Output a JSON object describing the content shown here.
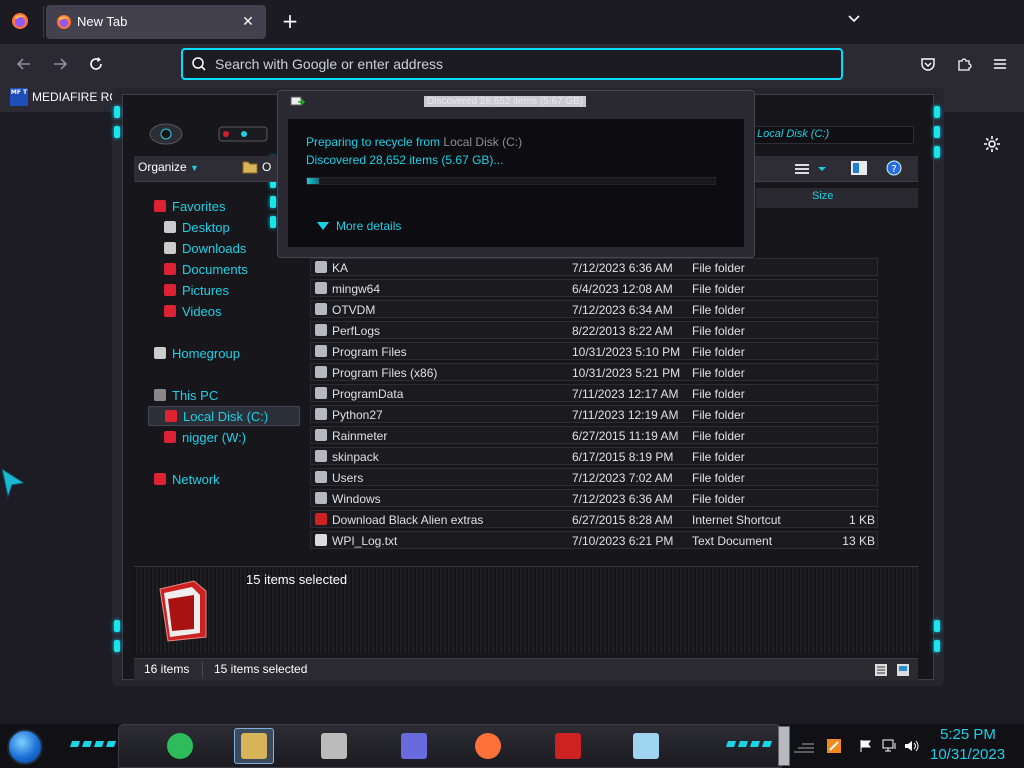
{
  "browser": {
    "tab": {
      "title": "New Tab",
      "close": "✕"
    },
    "new_tab": "+",
    "urlbar": {
      "placeholder": "Search with Google or enter address",
      "value": ""
    },
    "bookmark": {
      "icon_text": "MF T",
      "label": "MEDIAFIRE ROU"
    },
    "accent": "#00ddff"
  },
  "explorer": {
    "toolbar": {
      "organize": "Organize",
      "open_trunc": "O"
    },
    "address_right": "Local Disk (C:)",
    "column_size": "Size",
    "nav": [
      {
        "label": "Favorites",
        "icon": "star-icon"
      },
      {
        "label": "Desktop",
        "icon": "desktop-icon"
      },
      {
        "label": "Downloads",
        "icon": "downloads-icon"
      },
      {
        "label": "Documents",
        "icon": "documents-icon"
      },
      {
        "label": "Pictures",
        "icon": "pictures-icon"
      },
      {
        "label": "Videos",
        "icon": "videos-icon"
      },
      {
        "label": "Homegroup",
        "icon": "homegroup-icon"
      },
      {
        "label": "This PC",
        "icon": "computer-icon"
      },
      {
        "label": "Local Disk (C:)",
        "icon": "drive-icon"
      },
      {
        "label": "nigger (W:)",
        "icon": "drive-icon"
      },
      {
        "label": "Network",
        "icon": "network-icon"
      }
    ],
    "files": [
      {
        "name": "KA",
        "date": "7/12/2023 6:36 AM",
        "type": "File folder",
        "size": ""
      },
      {
        "name": "mingw64",
        "date": "6/4/2023 12:08 AM",
        "type": "File folder",
        "size": ""
      },
      {
        "name": "OTVDM",
        "date": "7/12/2023 6:34 AM",
        "type": "File folder",
        "size": ""
      },
      {
        "name": "PerfLogs",
        "date": "8/22/2013 8:22 AM",
        "type": "File folder",
        "size": ""
      },
      {
        "name": "Program Files",
        "date": "10/31/2023 5:10 PM",
        "type": "File folder",
        "size": ""
      },
      {
        "name": "Program Files (x86)",
        "date": "10/31/2023 5:21 PM",
        "type": "File folder",
        "size": ""
      },
      {
        "name": "ProgramData",
        "date": "7/11/2023 12:17 AM",
        "type": "File folder",
        "size": ""
      },
      {
        "name": "Python27",
        "date": "7/11/2023 12:19 AM",
        "type": "File folder",
        "size": ""
      },
      {
        "name": "Rainmeter",
        "date": "6/27/2015 11:19 AM",
        "type": "File folder",
        "size": ""
      },
      {
        "name": "skinpack",
        "date": "6/17/2015 8:19 PM",
        "type": "File folder",
        "size": ""
      },
      {
        "name": "Users",
        "date": "7/12/2023 7:02 AM",
        "type": "File folder",
        "size": ""
      },
      {
        "name": "Windows",
        "date": "7/12/2023 6:36 AM",
        "type": "File folder",
        "size": ""
      },
      {
        "name": "Download Black Alien extras",
        "date": "6/27/2015 8:28 AM",
        "type": "Internet Shortcut",
        "size": "1 KB"
      },
      {
        "name": "WPI_Log.txt",
        "date": "7/10/2023 6:21 PM",
        "type": "Text Document",
        "size": "13 KB"
      }
    ],
    "details": {
      "selected_text": "15 items selected"
    },
    "status": {
      "count": "16 items",
      "selected": "15 items selected"
    }
  },
  "dialog": {
    "title": "Discovered 28,652 items (5.67 GB)",
    "line1_prefix": "Preparing to recycle from ",
    "line1_source": "Local Disk (C:)",
    "line2": "Discovered 28,652 items (5.67 GB)...",
    "progress": 0.03,
    "more_details": "More details"
  },
  "taskbar": {
    "clock_time": "5:25 PM",
    "clock_date": "10/31/2023",
    "apps": [
      "spotify-icon",
      "file-explorer-icon",
      "printer-icon",
      "settings-panel-icon",
      "firefox-icon",
      "alien-app-icon",
      "disk-cleanup-icon"
    ]
  }
}
